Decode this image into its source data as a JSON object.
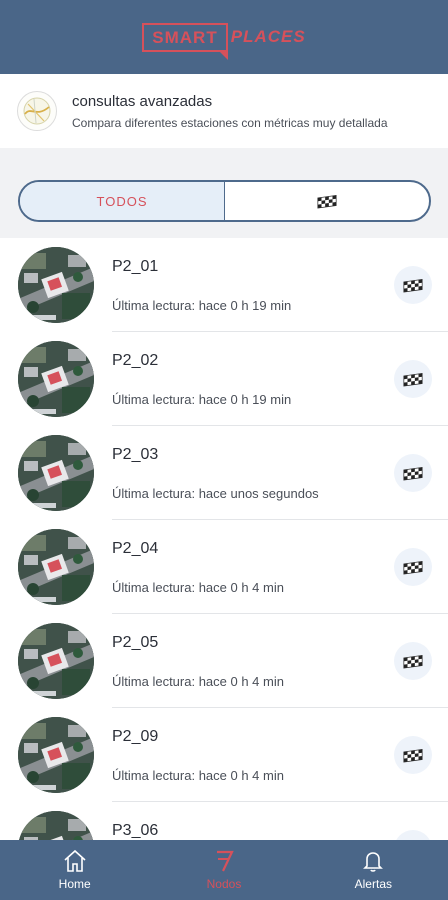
{
  "header": {
    "logo_part1": "SMART",
    "logo_part2": "PLACES"
  },
  "advanced": {
    "title": "consultas avanzadas",
    "subtitle": "Compara diferentes estaciones con métricas muy detallada"
  },
  "segment": {
    "all_label": "TODOS",
    "flag_icon": "checkered-flag-icon"
  },
  "nodes": [
    {
      "name": "P2_01",
      "reading": "Última lectura: hace 0 h 19 min"
    },
    {
      "name": "P2_02",
      "reading": "Última lectura: hace 0 h 19 min"
    },
    {
      "name": "P2_03",
      "reading": "Última lectura: hace unos segundos"
    },
    {
      "name": "P2_04",
      "reading": "Última lectura: hace 0 h 4 min"
    },
    {
      "name": "P2_05",
      "reading": "Última lectura: hace 0 h 4 min"
    },
    {
      "name": "P2_09",
      "reading": "Última lectura: hace 0 h 4 min"
    },
    {
      "name": "P3_06",
      "reading": ""
    }
  ],
  "bottom_nav": {
    "home": "Home",
    "nodes": "Nodos",
    "alerts": "Alertas"
  },
  "colors": {
    "primary": "#4a6688",
    "accent": "#d6515b",
    "segment_active_bg": "#e5eef8"
  }
}
